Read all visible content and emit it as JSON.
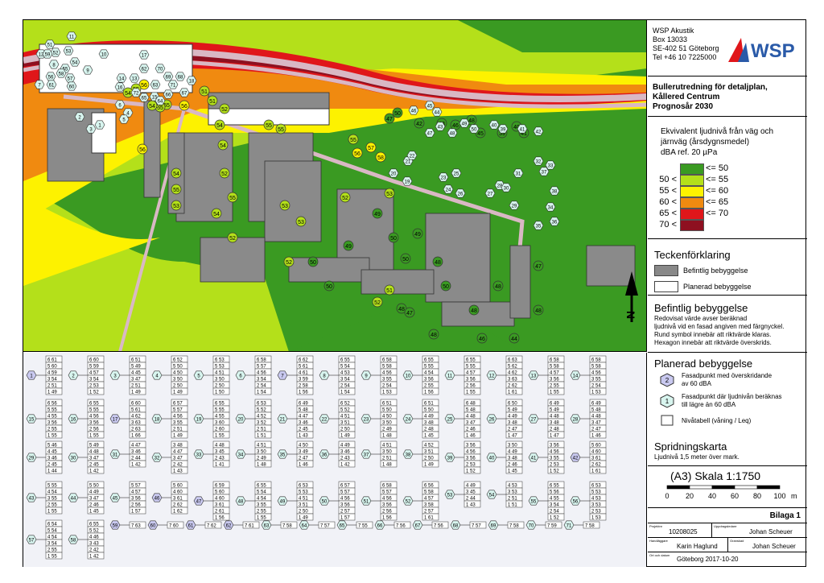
{
  "company": {
    "name": "WSP Akustik",
    "address1": "Box 13033",
    "address2": "SE-402 51 Göteborg",
    "phone": "Tel +46 10 7225000",
    "logo_text": "WSP"
  },
  "title": {
    "line1": "Bullerutredning för detaljplan,",
    "line2": "Kållered Centrum",
    "line3": "Prognosår 2030"
  },
  "noise_legend": {
    "heading1": "Ekvivalent ljudnivå från väg och",
    "heading2": "järnväg (årsdygnsmedel)",
    "heading3": "dBA ref. 20 µPa",
    "classes": [
      {
        "left": "",
        "right": "<= 50",
        "color": "#3a9a22"
      },
      {
        "left": "50 <",
        "right": "<= 55",
        "color": "#b4e01a"
      },
      {
        "left": "55 <",
        "right": "<= 60",
        "color": "#fdf200"
      },
      {
        "left": "60 <",
        "right": "<= 65",
        "color": "#f08a10"
      },
      {
        "left": "65 <",
        "right": "<= 70",
        "color": "#e0161a"
      },
      {
        "left": "70 <",
        "right": "",
        "color": "#8e1020"
      }
    ]
  },
  "key": {
    "heading": "Teckenförklaring",
    "existing": "Befintlig bebyggelse",
    "planned": "Planerad bebyggelse"
  },
  "existing_section": {
    "heading": "Befintlig bebyggelse",
    "line1": "Redovisat värde avser beräknad",
    "line2": "ljudnivå vid en fasad angiven med färgnyckel.",
    "line3": "Rund symbol innebär att riktvärde klaras.",
    "line4": "Hexagon innebär att riktvärde överskrids."
  },
  "planned_section": {
    "heading": "Planerad bebyggelse",
    "item1a": "Fasadpunkt med överskridande",
    "item1b": "av 60 dBA",
    "item1_sym": "2",
    "item2a": "Fasadpunkt där ljudnivån beräknas",
    "item2b": "till lägre än 60 dBA",
    "item2_sym": "1",
    "item3": "Nivåtabell (våning / Leq)"
  },
  "spread": {
    "heading": "Spridningskarta",
    "note": "Ljudnivå 1,5 meter över mark."
  },
  "scale": {
    "label": "(A3) Skala 1:1750",
    "ticks": [
      "0",
      "20",
      "40",
      "60",
      "80",
      "100"
    ],
    "unit": "m"
  },
  "titleblock": {
    "bilaga": "Bilaga 1",
    "projekt_label": "Projektnr",
    "projekt": "10208025",
    "uppdragsledare_label": "Uppdragsledare",
    "uppdragsledare": "Johan Scheuer",
    "handlaggare_label": "Handläggare",
    "handlaggare": "Karin Haglund",
    "granskad_label": "Granskad",
    "granskad": "Johan Scheuer",
    "ort_label": "Ort och datum",
    "ort": "Göteborg 2017-10-20"
  },
  "map_labels": {
    "north": "N",
    "existing_points": [
      "55",
      "56",
      "54",
      "54",
      "55",
      "54",
      "54",
      "53",
      "52",
      "55",
      "52",
      "52",
      "50",
      "52",
      "53",
      "53",
      "50",
      "49",
      "50",
      "49",
      "53",
      "49",
      "48",
      "50",
      "50",
      "52",
      "51",
      "48",
      "47",
      "48",
      "48",
      "46",
      "44",
      "48",
      "47",
      "48",
      "45",
      "39",
      "40",
      "41",
      "42",
      "43",
      "46",
      "48",
      "47",
      "50",
      "51",
      "55",
      "56",
      "57",
      "58",
      "56",
      "55",
      "54",
      "54",
      "56",
      "55",
      "54",
      "55",
      "55",
      "52",
      "51"
    ],
    "planned_points": [
      "1",
      "2",
      "3",
      "4",
      "5",
      "6",
      "7",
      "8",
      "9",
      "10",
      "11",
      "12",
      "13",
      "14",
      "15",
      "16",
      "17",
      "18",
      "19",
      "20",
      "21",
      "22",
      "23",
      "24",
      "25",
      "26",
      "27",
      "28",
      "29",
      "30",
      "31",
      "32",
      "33",
      "34",
      "35",
      "36",
      "37",
      "38",
      "39",
      "40",
      "41",
      "42",
      "43",
      "44",
      "45",
      "46",
      "47",
      "48",
      "49",
      "50",
      "51",
      "52",
      "53",
      "54",
      "55",
      "56",
      "57",
      "58",
      "59",
      "60",
      "61",
      "62",
      "63",
      "64",
      "65",
      "66",
      "67",
      "68",
      "69",
      "70",
      "71",
      "72"
    ]
  },
  "level_tables": {
    "row1": [
      {
        "id": "1",
        "vals": [
          "6 61",
          "5 60",
          "4 59",
          "3 54",
          "2 51",
          "1 49"
        ]
      },
      {
        "id": "2",
        "vals": [
          "6 60",
          "5 59",
          "4 57",
          "3 54",
          "2 53",
          "1 52"
        ]
      },
      {
        "id": "3",
        "vals": [
          "6 51",
          "5 49",
          "4 45",
          "3 47",
          "2 51",
          "1 49"
        ]
      },
      {
        "id": "4",
        "vals": [
          "6 52",
          "5 50",
          "4 50",
          "3 50",
          "2 50",
          "1 49"
        ]
      },
      {
        "id": "5",
        "vals": [
          "6 53",
          "5 53",
          "4 51",
          "3 50",
          "2 50",
          "1 50"
        ]
      },
      {
        "id": "6",
        "vals": [
          "6 58",
          "5 57",
          "4 56",
          "3 54",
          "2 54",
          "1 54"
        ]
      },
      {
        "id": "7",
        "vals": [
          "6 62",
          "5 61",
          "4 61",
          "3 59",
          "2 58",
          "1 56"
        ]
      },
      {
        "id": "8",
        "vals": [
          "6 55",
          "5 54",
          "4 53",
          "3 54",
          "2 54",
          "1 54"
        ]
      },
      {
        "id": "9",
        "vals": [
          "6 58",
          "5 58",
          "4 56",
          "3 55",
          "2 54",
          "1 53"
        ]
      },
      {
        "id": "10",
        "vals": [
          "6 55",
          "5 55",
          "4 54",
          "3 56",
          "2 55",
          "1 56"
        ]
      },
      {
        "id": "11",
        "vals": [
          "6 55",
          "5 55",
          "4 57",
          "3 56",
          "2 56",
          "1 55"
        ]
      },
      {
        "id": "12",
        "vals": [
          "6 63",
          "5 62",
          "4 62",
          "3 63",
          "2 62",
          "1 61"
        ]
      },
      {
        "id": "13",
        "vals": [
          "6 58",
          "5 58",
          "4 57",
          "3 56",
          "2 55",
          "1 55"
        ]
      },
      {
        "id": "14",
        "vals": [
          "6 58",
          "5 58",
          "4 56",
          "3 55",
          "2 54",
          "1 53"
        ]
      }
    ],
    "row2": [
      {
        "id": "15",
        "vals": [
          "6 56",
          "5 55",
          "4 55",
          "3 56",
          "2 55",
          "1 55"
        ]
      },
      {
        "id": "16",
        "vals": [
          "6 55",
          "5 55",
          "4 56",
          "3 56",
          "2 56",
          "1 55"
        ]
      },
      {
        "id": "17",
        "vals": [
          "6 60",
          "5 61",
          "4 62",
          "3 63",
          "2 63",
          "1 66"
        ]
      },
      {
        "id": "18",
        "vals": [
          "6 57",
          "5 57",
          "4 56",
          "3 55",
          "2 51",
          "1 49"
        ]
      },
      {
        "id": "19",
        "vals": [
          "6 55",
          "5 55",
          "4 55",
          "3 60",
          "2 60",
          "1 55"
        ]
      },
      {
        "id": "20",
        "vals": [
          "6 53",
          "5 52",
          "4 52",
          "3 52",
          "2 51",
          "1 51"
        ]
      },
      {
        "id": "21",
        "vals": [
          "6 49",
          "5 48",
          "4 47",
          "3 46",
          "2 45",
          "1 43"
        ]
      },
      {
        "id": "22",
        "vals": [
          "6 52",
          "5 52",
          "4 51",
          "3 51",
          "2 50",
          "1 49"
        ]
      },
      {
        "id": "23",
        "vals": [
          "6 51",
          "5 50",
          "4 50",
          "3 50",
          "2 49",
          "1 48"
        ]
      },
      {
        "id": "24",
        "vals": [
          "6 51",
          "5 50",
          "4 49",
          "3 48",
          "2 48",
          "1 45"
        ]
      },
      {
        "id": "25",
        "vals": [
          "6 48",
          "5 48",
          "4 48",
          "3 47",
          "2 46",
          "1 46"
        ]
      },
      {
        "id": "26",
        "vals": [
          "6 50",
          "5 49",
          "4 49",
          "3 48",
          "2 47",
          "1 47"
        ]
      },
      {
        "id": "27",
        "vals": [
          "6 49",
          "5 49",
          "4 48",
          "3 48",
          "2 48",
          "1 47"
        ]
      },
      {
        "id": "28",
        "vals": [
          "6 49",
          "5 48",
          "4 48",
          "3 47",
          "2 47",
          "1 46"
        ]
      }
    ],
    "row3": [
      {
        "id": "29",
        "vals": [
          "5 46",
          "4 45",
          "3 46",
          "2 45",
          "1 44"
        ]
      },
      {
        "id": "30",
        "vals": [
          "5 49",
          "4 48",
          "3 47",
          "2 45",
          "1 42"
        ]
      },
      {
        "id": "31",
        "vals": [
          "4 47",
          "3 46",
          "2 44",
          "1 42"
        ]
      },
      {
        "id": "32",
        "vals": [
          "3 48",
          "4 47",
          "3 47",
          "2 42",
          "1 43"
        ]
      },
      {
        "id": "33",
        "vals": [
          "4 48",
          "3 45",
          "2 43",
          "1 41"
        ]
      },
      {
        "id": "34",
        "vals": [
          "4 51",
          "3 50",
          "2 49",
          "1 48"
        ]
      },
      {
        "id": "35",
        "vals": [
          "4 50",
          "3 49",
          "2 47",
          "1 46"
        ]
      },
      {
        "id": "36",
        "vals": [
          "4 49",
          "3 46",
          "2 43",
          "1 42"
        ]
      },
      {
        "id": "37",
        "vals": [
          "4 51",
          "3 50",
          "2 51",
          "1 48"
        ]
      },
      {
        "id": "38",
        "vals": [
          "4 52",
          "3 51",
          "2 50",
          "1 49"
        ]
      },
      {
        "id": "39",
        "vals": [
          "3 56",
          "4 56",
          "3 56",
          "2 53",
          "1 52"
        ]
      },
      {
        "id": "40",
        "vals": [
          "3 50",
          "4 49",
          "3 48",
          "2 46",
          "1 45"
        ]
      },
      {
        "id": "41",
        "vals": [
          "3 56",
          "4 56",
          "3 55",
          "2 53",
          "1 52"
        ]
      },
      {
        "id": "42",
        "vals": [
          "5 60",
          "4 60",
          "3 61",
          "2 62",
          "1 61"
        ]
      }
    ],
    "row4": [
      {
        "id": "43",
        "vals": [
          "5 55",
          "4 54",
          "3 55",
          "2 55",
          "1 55"
        ]
      },
      {
        "id": "44",
        "vals": [
          "5 50",
          "4 49",
          "3 47",
          "2 46",
          "1 45"
        ]
      },
      {
        "id": "45",
        "vals": [
          "5 57",
          "4 57",
          "3 56",
          "2 56",
          "1 57"
        ]
      },
      {
        "id": "46",
        "vals": [
          "5 60",
          "4 60",
          "3 61",
          "2 62",
          "1 62"
        ]
      },
      {
        "id": "47",
        "vals": [
          "6 59",
          "5 60",
          "4 60",
          "3 61",
          "2 61",
          "1 56"
        ]
      },
      {
        "id": "48",
        "vals": [
          "6 55",
          "5 54",
          "4 54",
          "3 55",
          "2 55",
          "1 55"
        ]
      },
      {
        "id": "49",
        "vals": [
          "6 53",
          "5 53",
          "4 51",
          "3 51",
          "2 50",
          "1 49"
        ]
      },
      {
        "id": "50",
        "vals": [
          "6 57",
          "5 57",
          "4 56",
          "3 56",
          "2 57",
          "1 57"
        ]
      },
      {
        "id": "51",
        "vals": [
          "6 58",
          "5 57",
          "4 56",
          "3 56",
          "2 56",
          "1 56"
        ]
      },
      {
        "id": "52",
        "vals": [
          "6 56",
          "5 58",
          "4 57",
          "3 58",
          "2 57",
          "1 61"
        ]
      },
      {
        "id": "53",
        "vals": [
          "4 49",
          "3 45",
          "2 44",
          "1 43"
        ]
      },
      {
        "id": "54",
        "vals": [
          "4 53",
          "3 53",
          "2 51",
          "1 51"
        ]
      },
      {
        "id": "55",
        "vals": [
          "6 55",
          "5 56",
          "4 55",
          "3 54",
          "2 54",
          "1 52"
        ]
      },
      {
        "id": "56",
        "vals": [
          "6 53",
          "5 53",
          "4 53",
          "3 53",
          "2 53",
          "1 53"
        ]
      }
    ],
    "row5": [
      {
        "id": "57",
        "vals": [
          "6 54",
          "5 54",
          "4 54",
          "3 54",
          "2 55",
          "1 55"
        ]
      },
      {
        "id": "58",
        "vals": [
          "6 55",
          "5 52",
          "4 46",
          "3 43",
          "2 42",
          "1 42"
        ]
      }
    ],
    "row5_single": [
      {
        "id": "59",
        "val": "7 63"
      },
      {
        "id": "60",
        "val": "7 60"
      },
      {
        "id": "61",
        "val": "7 62"
      },
      {
        "id": "62",
        "val": "7 61"
      },
      {
        "id": "63",
        "val": "7 58"
      },
      {
        "id": "64",
        "val": "7 57"
      },
      {
        "id": "65",
        "val": "7 55"
      },
      {
        "id": "66",
        "val": "7 56"
      },
      {
        "id": "67",
        "val": "7 56"
      },
      {
        "id": "68",
        "val": "7 57"
      },
      {
        "id": "69",
        "val": "7 58"
      },
      {
        "id": "70",
        "val": "7 59"
      },
      {
        "id": "71",
        "val": "7 58"
      }
    ]
  }
}
